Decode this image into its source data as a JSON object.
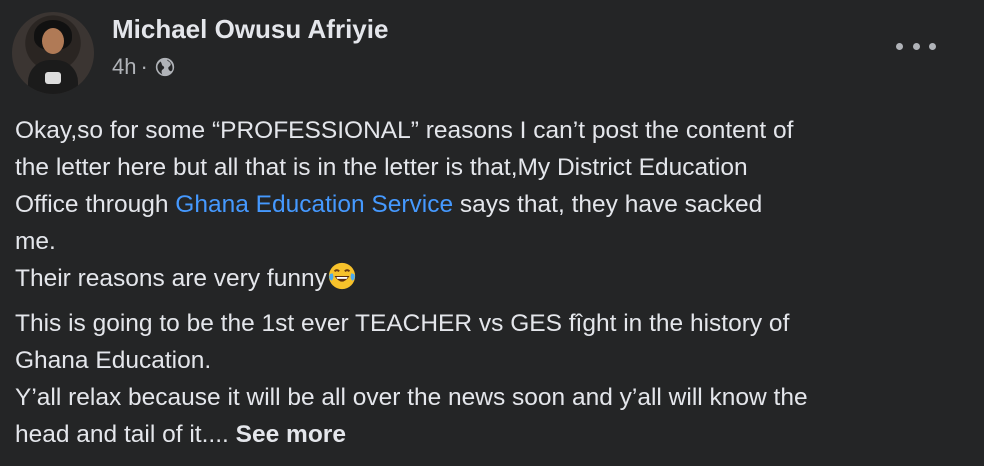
{
  "post": {
    "author": "Michael Owusu Afriyie",
    "time": "4h",
    "separator": "·",
    "privacy_icon": "globe-icon",
    "more_icon": "more-options-icon",
    "paragraph1": {
      "line1": "Okay,so for some “PROFESSIONAL” reasons I can’t post the content of",
      "line2": "the letter here but all that is in the letter is that,My District Education",
      "line3_pre": "Office through ",
      "line3_link": "Ghana Education Service",
      "line3_post": " says that, they have  sacked",
      "line4": "me.",
      "line5": "Their reasons are very funny",
      "emoji": "face-with-tears-of-joy-icon"
    },
    "paragraph2": {
      "line1": "This is going to be the 1st ever TEACHER vs GES fîght in the history of",
      "line2": "Ghana Education.",
      "line3": "Y’all relax because it will be all over the news soon and y’all will know the",
      "line4": "head and tail of it.... ",
      "see_more": "See more"
    }
  },
  "colors": {
    "background": "#242526",
    "primary_text": "#e4e6eb",
    "secondary_text": "#b0b3b8",
    "link": "#4599ff"
  }
}
